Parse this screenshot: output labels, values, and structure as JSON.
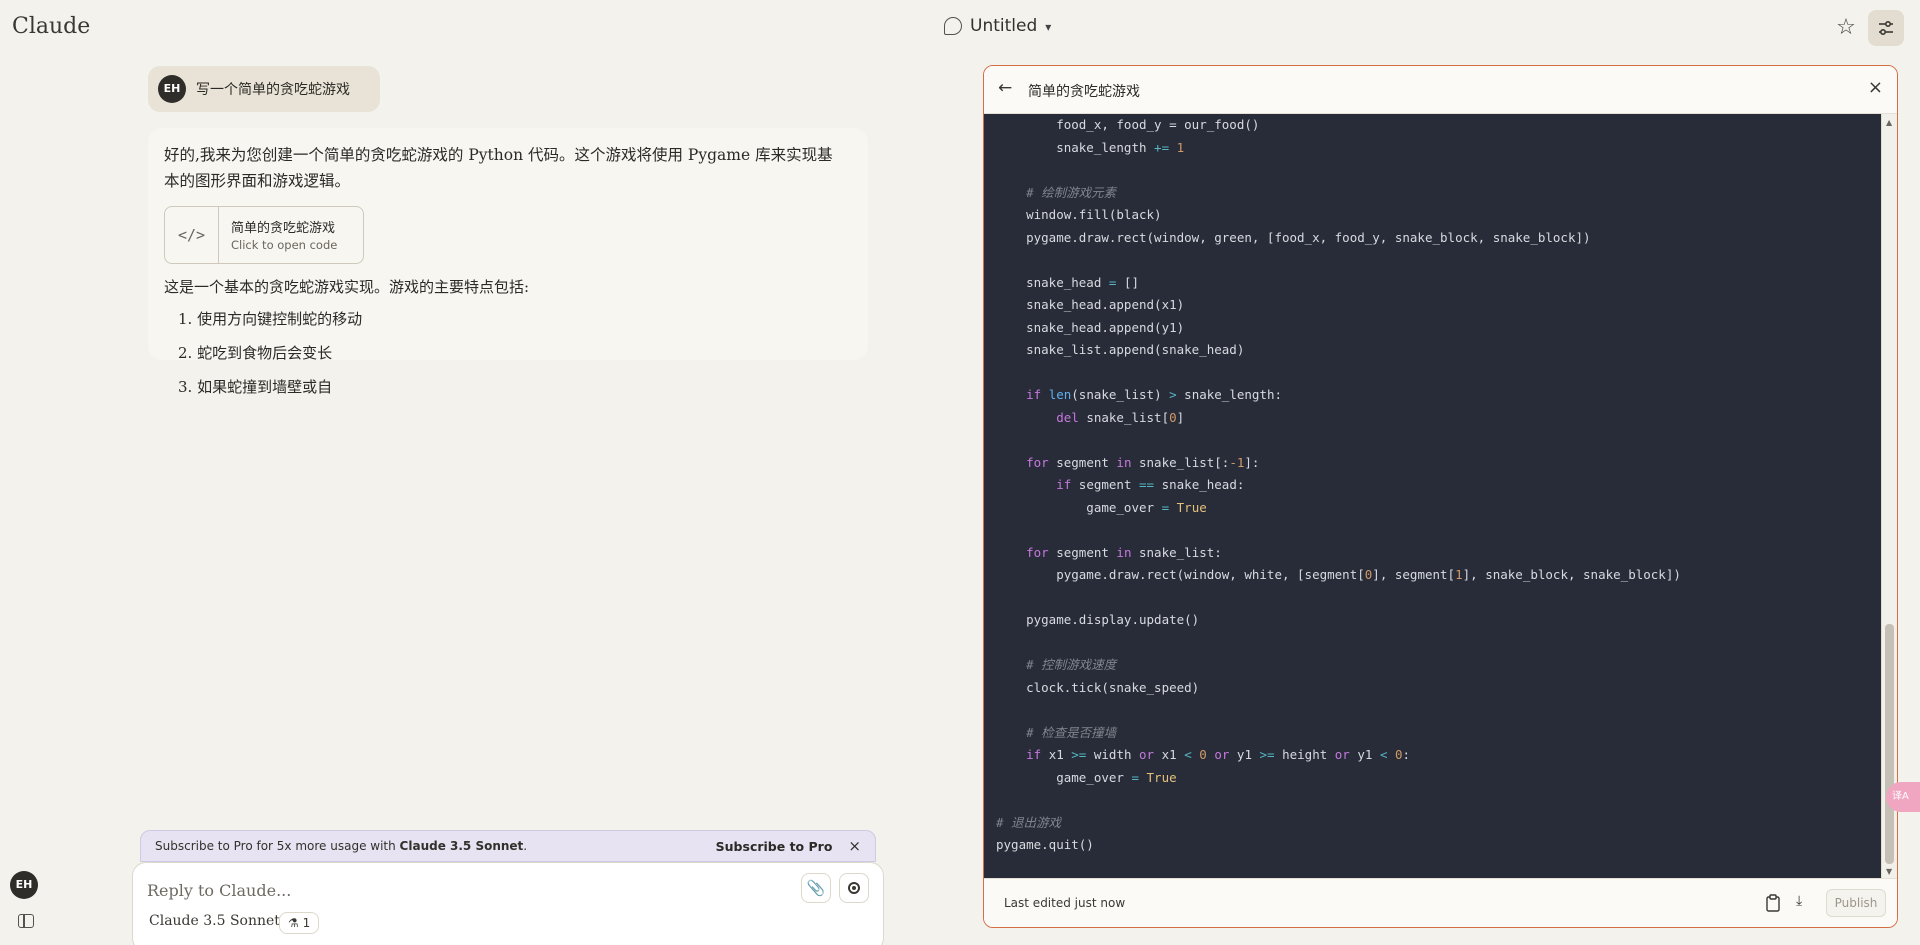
{
  "app": {
    "brand": "Claude"
  },
  "header": {
    "conversation_title": "Untitled",
    "chevron": "▾",
    "star_glyph": "☆"
  },
  "user_message": {
    "avatar": "EH",
    "text": "写一个简单的贪吃蛇游戏"
  },
  "assistant": {
    "intro": "好的,我来为您创建一个简单的贪吃蛇游戏的 Python 代码。这个游戏将使用 Pygame 库来实现基本的图形界面和游戏逻辑。",
    "artifact_card": {
      "icon_glyph": "</>",
      "title": "简单的贪吃蛇游戏",
      "subtitle": "Click to open code"
    },
    "features_intro": "这是一个基本的贪吃蛇游戏实现。游戏的主要特点包括:",
    "features": [
      "1. 使用方向键控制蛇的移动",
      "2. 蛇吃到食物后会变长",
      "3. 如果蛇撞到墙壁或自"
    ]
  },
  "pro_banner": {
    "text_prefix": "Subscribe to Pro for 5x more usage with ",
    "text_bold": "Claude 3.5 Sonnet",
    "text_suffix": ".",
    "link": "Subscribe to Pro",
    "close_glyph": "×"
  },
  "composer": {
    "placeholder": "Reply to Claude...",
    "attach_glyph": "📎",
    "model": "Claude 3.5 Sonnet",
    "tools_badge": "⚗ 1"
  },
  "sidebar": {
    "avatar": "EH"
  },
  "artifact_panel": {
    "back_glyph": "←",
    "title": "简单的贪吃蛇游戏",
    "close_glyph": "×",
    "footer": {
      "edited": "Last edited just now",
      "download_glyph": "⤓",
      "publish": "Publish"
    },
    "code_lines": [
      [
        {
          "t": "        food_x, food_y = our_food()"
        }
      ],
      [
        {
          "t": "        snake_length "
        },
        {
          "t": "+=",
          "c": "op"
        },
        {
          "t": " "
        },
        {
          "t": "1",
          "c": "num"
        }
      ],
      [],
      [
        {
          "t": "    # 绘制游戏元素",
          "c": "cm"
        }
      ],
      [
        {
          "t": "    window.fill(black)"
        }
      ],
      [
        {
          "t": "    pygame.draw.rect(window, green, [food_x, food_y, snake_block, snake_block])"
        }
      ],
      [],
      [
        {
          "t": "    snake_head "
        },
        {
          "t": "=",
          "c": "op"
        },
        {
          "t": " []"
        }
      ],
      [
        {
          "t": "    snake_head.append(x1)"
        }
      ],
      [
        {
          "t": "    snake_head.append(y1)"
        }
      ],
      [
        {
          "t": "    snake_list.append(snake_head)"
        }
      ],
      [],
      [
        {
          "t": "    "
        },
        {
          "t": "if",
          "c": "kw"
        },
        {
          "t": " "
        },
        {
          "t": "len",
          "c": "fn"
        },
        {
          "t": "(snake_list) "
        },
        {
          "t": ">",
          "c": "op"
        },
        {
          "t": " snake_length:"
        }
      ],
      [
        {
          "t": "        "
        },
        {
          "t": "del",
          "c": "kw"
        },
        {
          "t": " snake_list["
        },
        {
          "t": "0",
          "c": "num"
        },
        {
          "t": "]"
        }
      ],
      [],
      [
        {
          "t": "    "
        },
        {
          "t": "for",
          "c": "kw"
        },
        {
          "t": " segment "
        },
        {
          "t": "in",
          "c": "kw"
        },
        {
          "t": " snake_list[:"
        },
        {
          "t": "-1",
          "c": "num"
        },
        {
          "t": "]:"
        }
      ],
      [
        {
          "t": "        "
        },
        {
          "t": "if",
          "c": "kw"
        },
        {
          "t": " segment "
        },
        {
          "t": "==",
          "c": "op"
        },
        {
          "t": " snake_head:"
        }
      ],
      [
        {
          "t": "            game_over "
        },
        {
          "t": "=",
          "c": "op"
        },
        {
          "t": " "
        },
        {
          "t": "True",
          "c": "const"
        }
      ],
      [],
      [
        {
          "t": "    "
        },
        {
          "t": "for",
          "c": "kw"
        },
        {
          "t": " segment "
        },
        {
          "t": "in",
          "c": "kw"
        },
        {
          "t": " snake_list:"
        }
      ],
      [
        {
          "t": "        pygame.draw.rect(window, white, [segment["
        },
        {
          "t": "0",
          "c": "num"
        },
        {
          "t": "], segment["
        },
        {
          "t": "1",
          "c": "num"
        },
        {
          "t": "], snake_block, snake_block])"
        }
      ],
      [],
      [
        {
          "t": "    pygame.display.update()"
        }
      ],
      [],
      [
        {
          "t": "    # 控制游戏速度",
          "c": "cm"
        }
      ],
      [
        {
          "t": "    clock.tick(snake_speed)"
        }
      ],
      [],
      [
        {
          "t": "    # 检查是否撞墙",
          "c": "cm"
        }
      ],
      [
        {
          "t": "    "
        },
        {
          "t": "if",
          "c": "kw"
        },
        {
          "t": " x1 "
        },
        {
          "t": ">=",
          "c": "op"
        },
        {
          "t": " width "
        },
        {
          "t": "or",
          "c": "kw"
        },
        {
          "t": " x1 "
        },
        {
          "t": "<",
          "c": "op"
        },
        {
          "t": " "
        },
        {
          "t": "0",
          "c": "num"
        },
        {
          "t": " "
        },
        {
          "t": "or",
          "c": "kw"
        },
        {
          "t": " y1 "
        },
        {
          "t": ">=",
          "c": "op"
        },
        {
          "t": " height "
        },
        {
          "t": "or",
          "c": "kw"
        },
        {
          "t": " y1 "
        },
        {
          "t": "<",
          "c": "op"
        },
        {
          "t": " "
        },
        {
          "t": "0",
          "c": "num"
        },
        {
          "t": ":"
        }
      ],
      [
        {
          "t": "        game_over "
        },
        {
          "t": "=",
          "c": "op"
        },
        {
          "t": " "
        },
        {
          "t": "True",
          "c": "const"
        }
      ],
      [],
      [
        {
          "t": "# 退出游戏",
          "c": "cm"
        }
      ],
      [
        {
          "t": "pygame.quit()"
        }
      ]
    ]
  },
  "floating_tab": {
    "text": "译A"
  },
  "colors": {
    "panel_border": "#d56e45",
    "code_bg": "#272c38",
    "keyword": "#c678dd",
    "number": "#d19a66",
    "comment": "#7f848e"
  }
}
